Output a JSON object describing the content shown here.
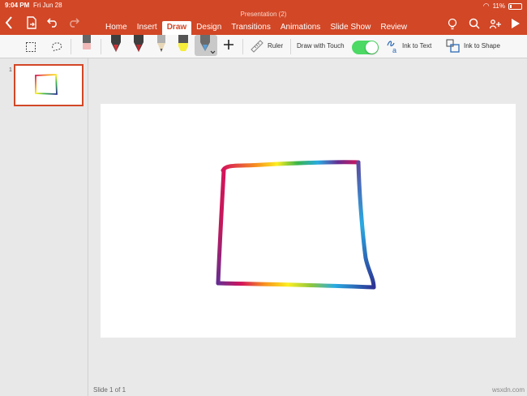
{
  "status": {
    "time": "9:04 PM",
    "date": "Fri Jun 28",
    "battery": "11%"
  },
  "document": {
    "title": "Presentation (2)"
  },
  "ribbon": {
    "tabs": [
      {
        "label": "Home"
      },
      {
        "label": "Insert"
      },
      {
        "label": "Draw",
        "active": true
      },
      {
        "label": "Design"
      },
      {
        "label": "Transitions"
      },
      {
        "label": "Animations"
      },
      {
        "label": "Slide Show"
      },
      {
        "label": "Review"
      }
    ]
  },
  "toolbar": {
    "ruler_label": "Ruler",
    "draw_with_touch_label": "Draw with Touch",
    "draw_with_touch_on": true,
    "ink_to_text_label": "Ink to Text",
    "ink_to_shape_label": "Ink to Shape",
    "pens": [
      {
        "icon": "eraser-icon",
        "color": "#f2b9b9"
      },
      {
        "icon": "pen-icon",
        "color": "#d1343a"
      },
      {
        "icon": "pen-icon",
        "color": "#c1272d"
      },
      {
        "icon": "pencil-icon",
        "color": "#9a9a9a"
      },
      {
        "icon": "highlighter-icon",
        "color": "#f6ee3a"
      },
      {
        "icon": "rainbow-pen-icon",
        "color": "#6b6b6b"
      }
    ]
  },
  "slides_pane": {
    "slide_number": "1"
  },
  "footer": {
    "slide_status": "Slide 1 of 1",
    "watermark": "wsxdn.com"
  },
  "colors": {
    "accent": "#d24726",
    "toggle_on": "#4cd964"
  }
}
